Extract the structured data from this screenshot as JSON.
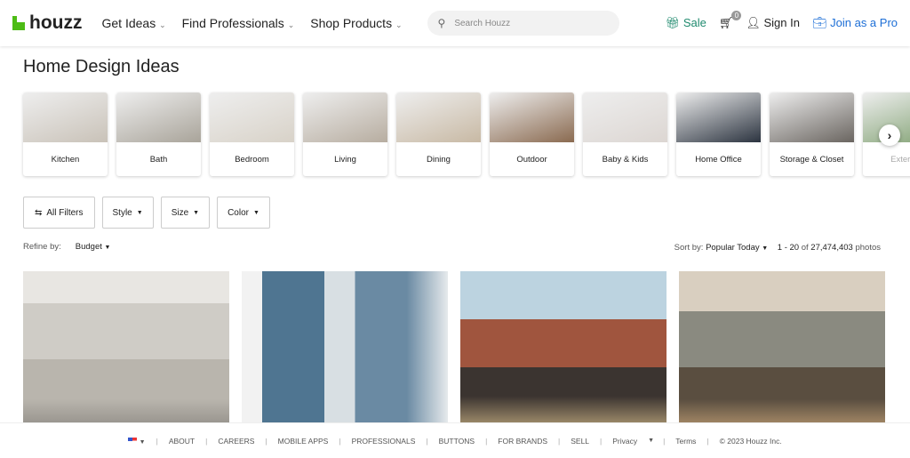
{
  "header": {
    "logo": "houzz",
    "nav": [
      "Get Ideas",
      "Find Professionals",
      "Shop Products"
    ],
    "search_placeholder": "Search Houzz",
    "sale": "Sale",
    "cart_count": "0",
    "sign_in": "Sign In",
    "join": "Join as a Pro"
  },
  "page_title": "Home Design Ideas",
  "categories": [
    "Kitchen",
    "Bath",
    "Bedroom",
    "Living",
    "Dining",
    "Outdoor",
    "Baby & Kids",
    "Home Office",
    "Storage & Closet",
    "Exterior"
  ],
  "filters": {
    "all": "All Filters",
    "items": [
      "Style",
      "Size",
      "Color"
    ]
  },
  "refine": {
    "label": "Refine by:",
    "budget": "Budget"
  },
  "sort": {
    "label": "Sort by:",
    "value": "Popular Today",
    "range": "1 - 20",
    "of": "of",
    "total": "27,474,403",
    "unit": "photos"
  },
  "footer": [
    "ABOUT",
    "CAREERS",
    "MOBILE APPS",
    "PROFESSIONALS",
    "BUTTONS",
    "FOR BRANDS",
    "SELL",
    "Privacy",
    "Terms",
    "© 2023 Houzz Inc."
  ],
  "colors": {
    "brand": "#4dbc15",
    "sale": "#1f8a6e",
    "join": "#1c6ed6"
  }
}
